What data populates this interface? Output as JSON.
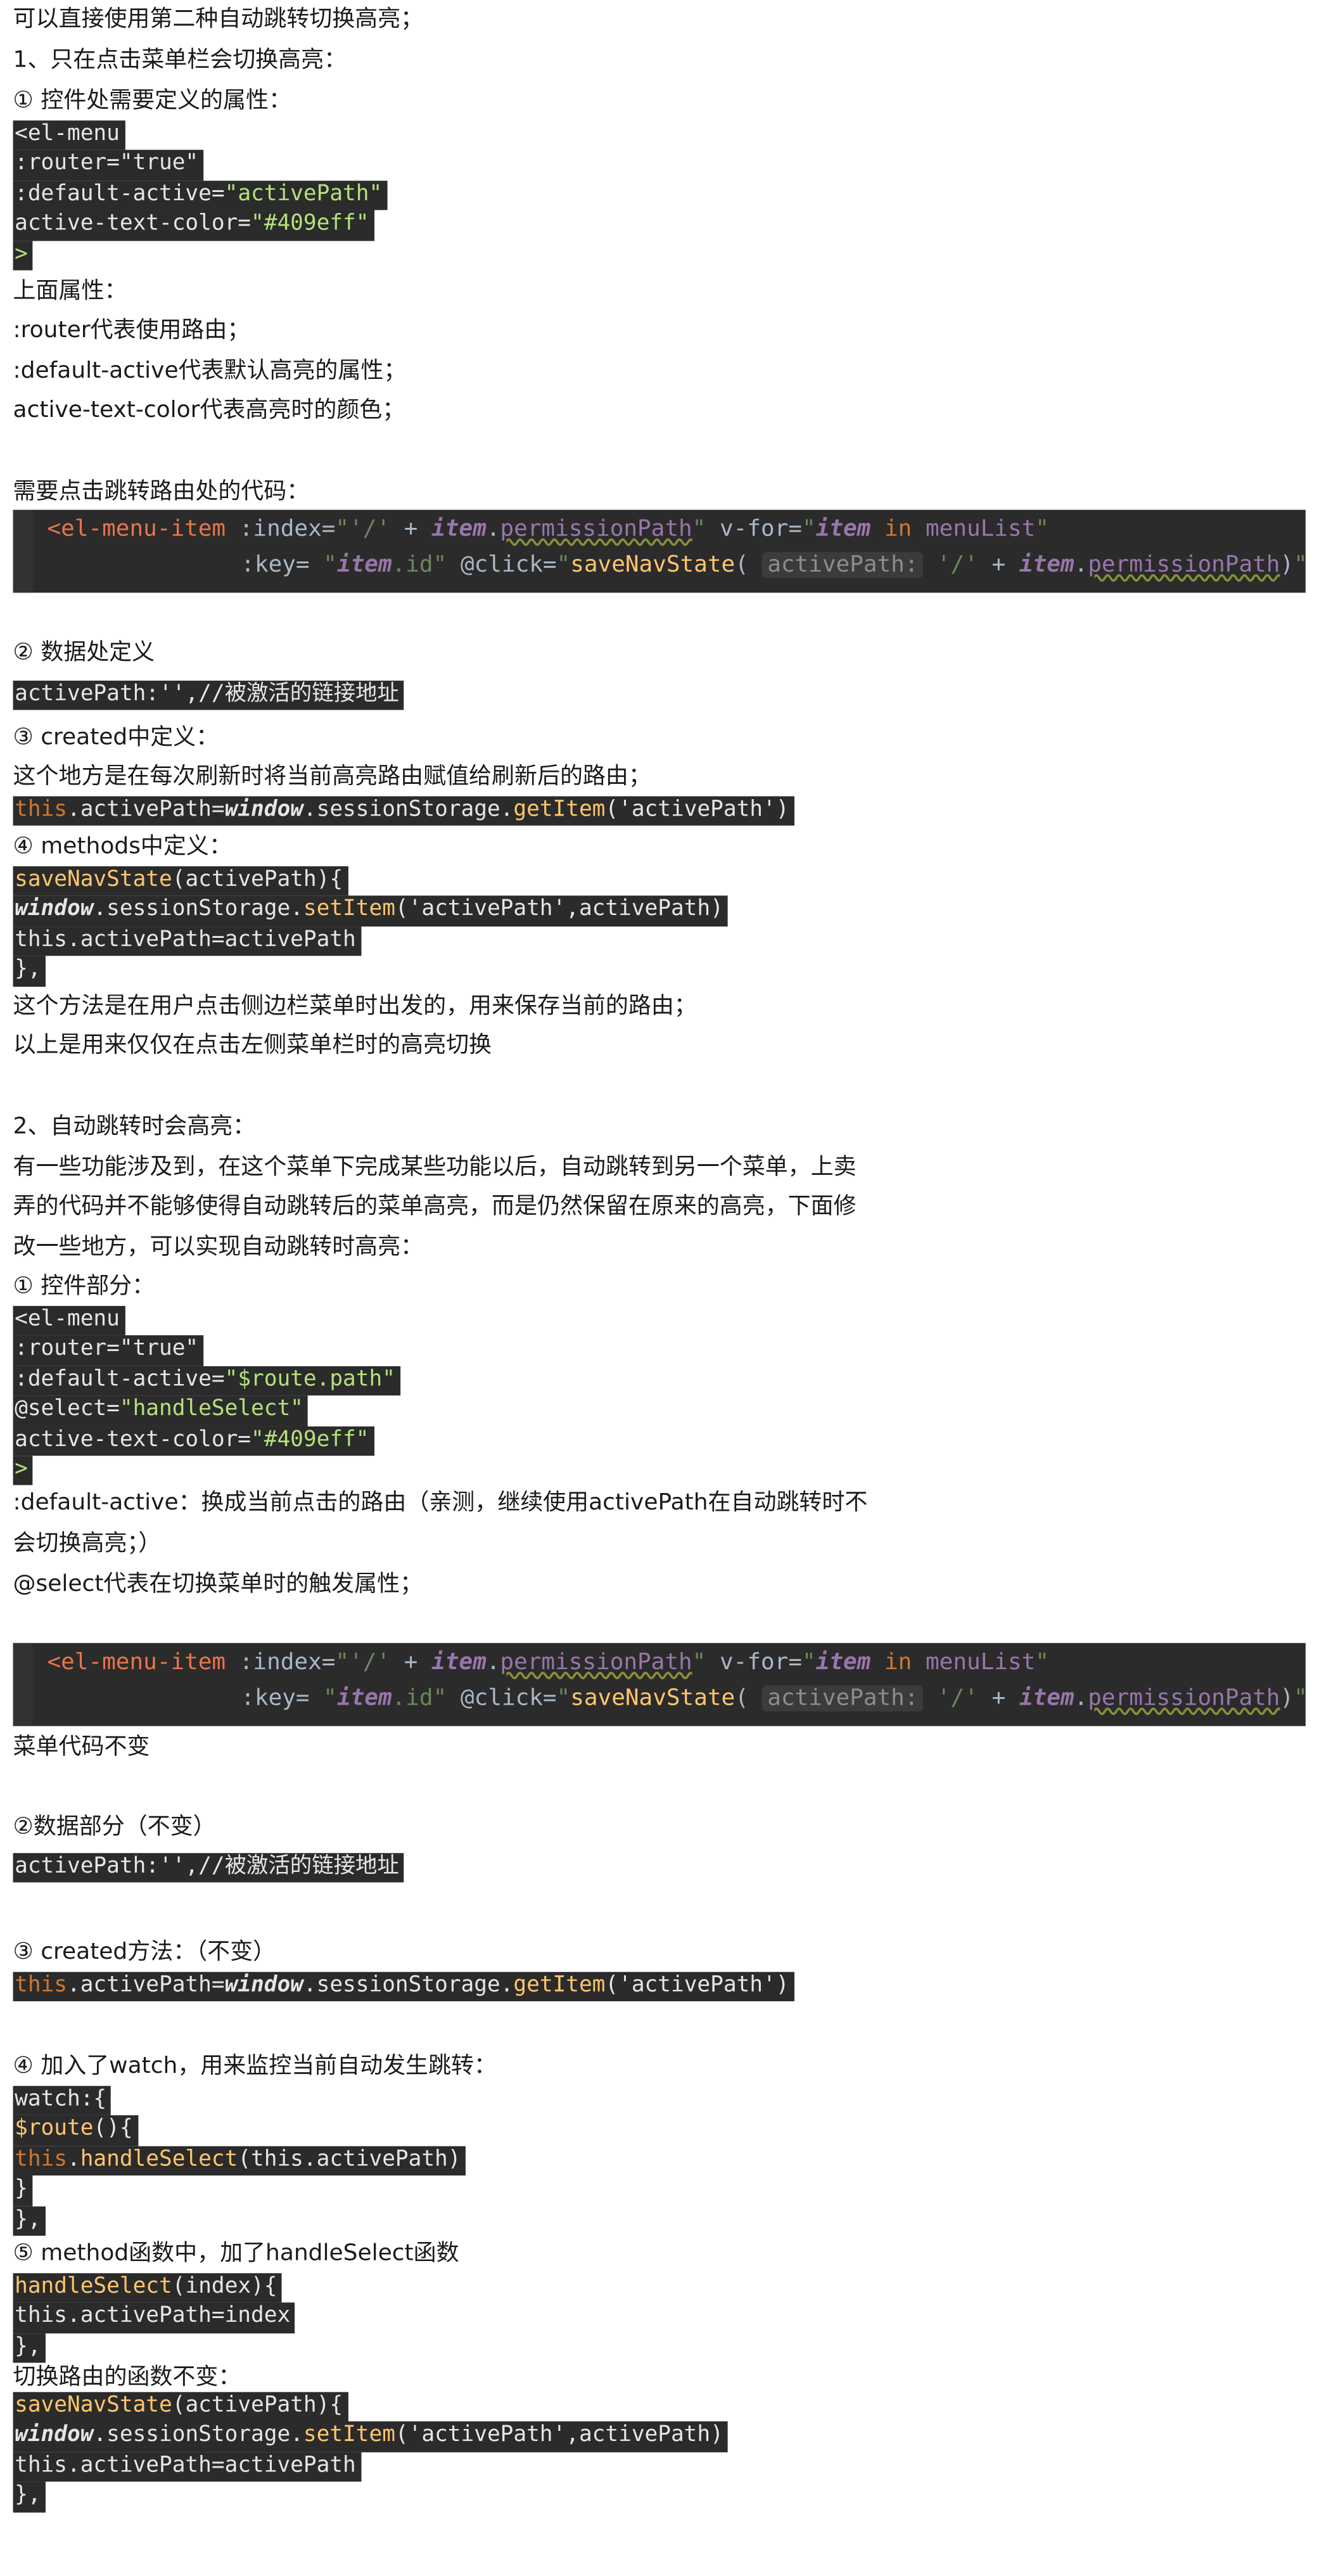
{
  "lines": {
    "l1": "可以直接使用第二种自动跳转切换高亮；",
    "l2": "1、只在点击菜单栏会切换高亮：",
    "l3": "① 控件处需要定义的属性：",
    "l9": "上面属性：",
    "l10": ":router代表使用路由；",
    "l11": ":default-active代表默认高亮的属性；",
    "l12": "active-text-color代表高亮时的颜色；",
    "l13": "需要点击跳转路由处的代码：",
    "l14": "② 数据处定义",
    "l15": "③ created中定义：",
    "l16": "这个地方是在每次刷新时将当前高亮路由赋值给刷新后的路由；",
    "l17": "④ methods中定义：",
    "l18": "这个方法是在用户点击侧边栏菜单时出发的，用来保存当前的路由；",
    "l19": "以上是用来仅仅在点击左侧菜单栏时的高亮切换",
    "l20": "2、自动跳转时会高亮：",
    "l21": "有一些功能涉及到，在这个菜单下完成某些功能以后，自动跳转到另一个菜单，上卖",
    "l22": "弄的代码并不能够使得自动跳转后的菜单高亮，而是仍然保留在原来的高亮，下面修",
    "l23": "改一些地方，可以实现自动跳转时高亮：",
    "l24": "① 控件部分：",
    "l25": ":default-active：换成当前点击的路由（亲测，继续使用activePath在自动跳转时不",
    "l26": "会切换高亮；）",
    "l27": "@select代表在切换菜单时的触发属性；",
    "l28": "菜单代码不变",
    "l29": "②数据部分（不变）",
    "l30": "③ created方法：（不变）",
    "l31": "④ 加入了watch，用来监控当前自动发生跳转：",
    "l32": "⑤ method函数中，加了handleSelect函数",
    "l33": "切换路由的函数不变："
  },
  "code": {
    "el_menu": "<el-menu",
    "router": ":router=\"true\"",
    "da_attr": ":default-active=",
    "da_val1": "\"activePath\"",
    "atc_attr": "active-text-color=",
    "atc_val": "\"#409eff\"",
    "gt": ">",
    "activepath_def": "activePath:'',//被激活的链接地址",
    "this": "this",
    "assign_get": ".activePath=",
    "window": "window",
    "session": ".sessionStorage.",
    "getItem": "getItem",
    "get_args": "('activePath')",
    "saveNavState": "saveNavState",
    "save_args": "(activePath){",
    "setItem": "setItem",
    "set_args": "('activePath',activePath)",
    "assign_ap": "this.activePath=activePath",
    "close_comma": "},",
    "da_val2": "\"$route.path\"",
    "select_attr": "@select=",
    "select_val": "\"handleSelect\"",
    "watch": "watch:{",
    "route": "$route",
    "route_rest": "(){",
    "handleSelect": "handleSelect",
    "hs_call_args": "(this.activePath)",
    "close": "}",
    "hs_def_args": "(index){",
    "assign_index": "this.activePath=index"
  },
  "ide": {
    "tag": "<el-menu-item",
    "index_attr": ":index=",
    "q": "\"",
    "slash": "'/'",
    "plus": " + ",
    "item": "item",
    "dot": ".",
    "perm": "permissionPath",
    "vfor": " v-for=",
    "in": "in",
    "menuList": "menuList",
    "key_attr": ":key= ",
    "id": ".id",
    "click": " @click=",
    "save": "saveNavState",
    "open": "(",
    "hint": "activePath:",
    "close": ")",
    "gt": ">"
  }
}
